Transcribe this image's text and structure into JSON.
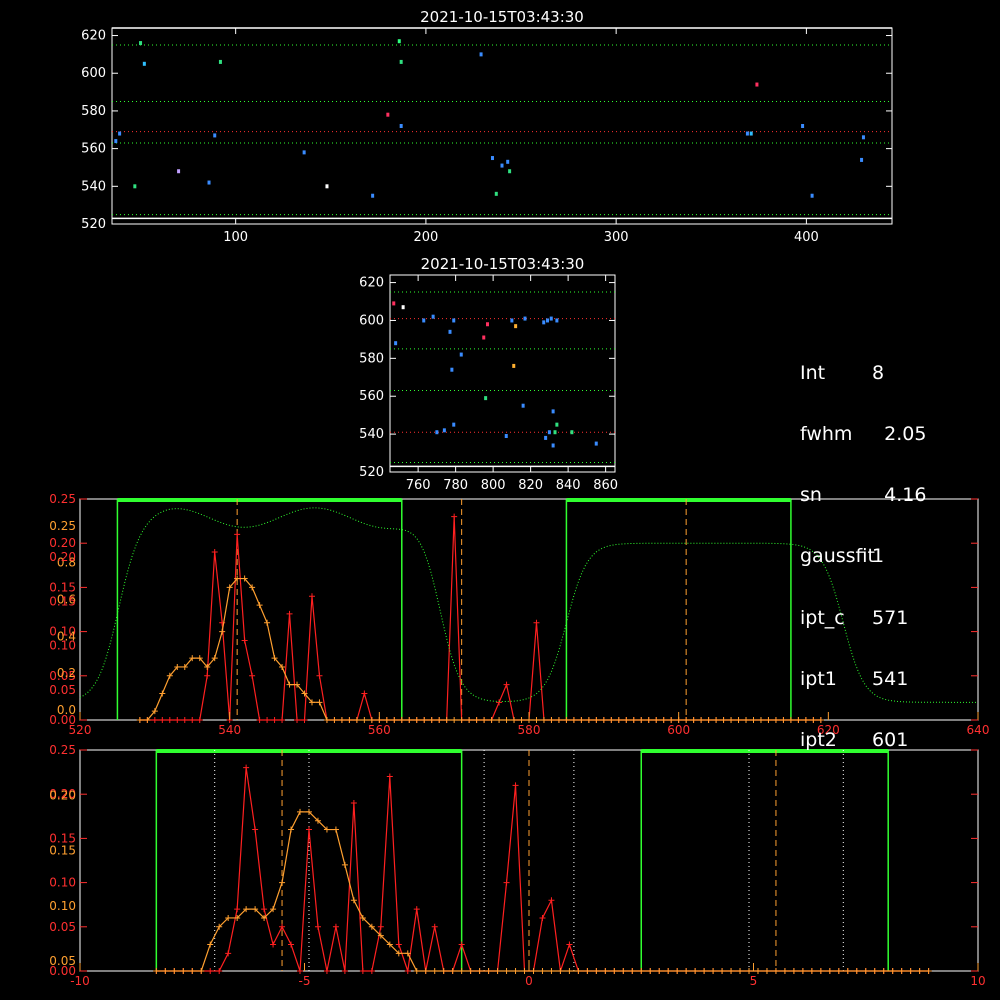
{
  "chart_data": [
    {
      "id": "top-image",
      "type": "scatter",
      "title": "2021-10-15T03:43:30",
      "xlim": [
        35,
        445
      ],
      "ylim": [
        520,
        624
      ],
      "xticks": [
        100,
        200,
        300,
        400
      ],
      "yticks": [
        520,
        540,
        560,
        580,
        600,
        620
      ],
      "hlines": [
        {
          "y": 569,
          "color": "#ff3030"
        },
        {
          "y": 585,
          "color": "#30ff30"
        },
        {
          "y": 563,
          "color": "#30ff30"
        },
        {
          "y": 615,
          "color": "#30ff30"
        },
        {
          "y": 525,
          "color": "#30ff30"
        },
        {
          "y": 624,
          "color": "#ffffff"
        },
        {
          "y": 523,
          "color": "#ffffff"
        }
      ],
      "points": [
        {
          "x": 37,
          "y": 564,
          "c": "#3a8cff"
        },
        {
          "x": 39,
          "y": 568,
          "c": "#3a8cff"
        },
        {
          "x": 47,
          "y": 540,
          "c": "#30e080"
        },
        {
          "x": 50,
          "y": 616,
          "c": "#30e080"
        },
        {
          "x": 52,
          "y": 605,
          "c": "#30c0ff"
        },
        {
          "x": 70,
          "y": 548,
          "c": "#c0a0ff"
        },
        {
          "x": 86,
          "y": 542,
          "c": "#3a8cff"
        },
        {
          "x": 89,
          "y": 567,
          "c": "#3a8cff"
        },
        {
          "x": 92,
          "y": 606,
          "c": "#30e080"
        },
        {
          "x": 136,
          "y": 558,
          "c": "#3a8cff"
        },
        {
          "x": 148,
          "y": 540,
          "c": "#ffffff"
        },
        {
          "x": 172,
          "y": 535,
          "c": "#3a8cff"
        },
        {
          "x": 180,
          "y": 578,
          "c": "#ff3060"
        },
        {
          "x": 186,
          "y": 617,
          "c": "#30ff80"
        },
        {
          "x": 187,
          "y": 606,
          "c": "#30e080"
        },
        {
          "x": 187,
          "y": 572,
          "c": "#3a8cff"
        },
        {
          "x": 229,
          "y": 610,
          "c": "#3a8cff"
        },
        {
          "x": 235,
          "y": 555,
          "c": "#3a8cff"
        },
        {
          "x": 237,
          "y": 536,
          "c": "#30e080"
        },
        {
          "x": 240,
          "y": 551,
          "c": "#3a8cff"
        },
        {
          "x": 243,
          "y": 553,
          "c": "#3a8cff"
        },
        {
          "x": 244,
          "y": 548,
          "c": "#30e080"
        },
        {
          "x": 369,
          "y": 568,
          "c": "#3a8cff"
        },
        {
          "x": 371,
          "y": 568,
          "c": "#30c0ff"
        },
        {
          "x": 374,
          "y": 594,
          "c": "#ff3060"
        },
        {
          "x": 398,
          "y": 572,
          "c": "#3a8cff"
        },
        {
          "x": 403,
          "y": 535,
          "c": "#3a8cff"
        },
        {
          "x": 429,
          "y": 554,
          "c": "#3a8cff"
        },
        {
          "x": 430,
          "y": 566,
          "c": "#3a8cff"
        }
      ]
    },
    {
      "id": "mid-image",
      "type": "scatter",
      "title": "2021-10-15T03:43:30",
      "xlim": [
        745,
        865
      ],
      "ylim": [
        520,
        624
      ],
      "xticks": [
        760,
        780,
        800,
        820,
        840,
        860
      ],
      "yticks": [
        520,
        540,
        560,
        580,
        600,
        620
      ],
      "hlines": [
        {
          "y": 601,
          "color": "#ff3030"
        },
        {
          "y": 541,
          "color": "#ff3030"
        },
        {
          "y": 615,
          "color": "#30ff30"
        },
        {
          "y": 585,
          "color": "#30ff30"
        },
        {
          "y": 563,
          "color": "#30ff30"
        },
        {
          "y": 525,
          "color": "#30ff30"
        },
        {
          "y": 523,
          "color": "#ffffff"
        }
      ],
      "points": [
        {
          "x": 747,
          "y": 609,
          "c": "#ff3060"
        },
        {
          "x": 748,
          "y": 588,
          "c": "#3a8cff"
        },
        {
          "x": 752,
          "y": 607,
          "c": "#ffffff"
        },
        {
          "x": 763,
          "y": 600,
          "c": "#3a8cff"
        },
        {
          "x": 768,
          "y": 602,
          "c": "#3a8cff"
        },
        {
          "x": 770,
          "y": 541,
          "c": "#3a8cff"
        },
        {
          "x": 774,
          "y": 542,
          "c": "#3a8cff"
        },
        {
          "x": 777,
          "y": 594,
          "c": "#3a8cff"
        },
        {
          "x": 778,
          "y": 574,
          "c": "#3a8cff"
        },
        {
          "x": 779,
          "y": 600,
          "c": "#3a8cff"
        },
        {
          "x": 779,
          "y": 545,
          "c": "#3a8cff"
        },
        {
          "x": 783,
          "y": 582,
          "c": "#3a8cff"
        },
        {
          "x": 795,
          "y": 591,
          "c": "#ff3060"
        },
        {
          "x": 796,
          "y": 559,
          "c": "#30e080"
        },
        {
          "x": 797,
          "y": 598,
          "c": "#ff3060"
        },
        {
          "x": 807,
          "y": 539,
          "c": "#3a8cff"
        },
        {
          "x": 810,
          "y": 600,
          "c": "#3a8cff"
        },
        {
          "x": 811,
          "y": 576,
          "c": "#ffb030"
        },
        {
          "x": 812,
          "y": 597,
          "c": "#ffb030"
        },
        {
          "x": 816,
          "y": 555,
          "c": "#3a8cff"
        },
        {
          "x": 817,
          "y": 601,
          "c": "#3a8cff"
        },
        {
          "x": 827,
          "y": 599,
          "c": "#3a8cff"
        },
        {
          "x": 828,
          "y": 538,
          "c": "#3a8cff"
        },
        {
          "x": 829,
          "y": 600,
          "c": "#3a8cff"
        },
        {
          "x": 830,
          "y": 541,
          "c": "#3a8cff"
        },
        {
          "x": 831,
          "y": 601,
          "c": "#3a8cff"
        },
        {
          "x": 832,
          "y": 552,
          "c": "#3a8cff"
        },
        {
          "x": 832,
          "y": 534,
          "c": "#3a8cff"
        },
        {
          "x": 833,
          "y": 541,
          "c": "#30e080"
        },
        {
          "x": 834,
          "y": 600,
          "c": "#3a8cff"
        },
        {
          "x": 834,
          "y": 545,
          "c": "#30e080"
        },
        {
          "x": 842,
          "y": 541,
          "c": "#30e080"
        },
        {
          "x": 855,
          "y": 535,
          "c": "#3a8cff"
        }
      ]
    },
    {
      "id": "profile-pixel",
      "type": "line",
      "xlim": [
        520,
        640
      ],
      "xticks": [
        520,
        540,
        560,
        580,
        600,
        620,
        640
      ],
      "yleft_ticks": [
        "0.00",
        "0.05",
        "0.10",
        "0.15",
        "0.20",
        "0.25"
      ],
      "yleft2_ticks": [
        "0.0",
        "0.2",
        "0.4",
        "0.6",
        "0.8",
        "0.25"
      ],
      "yleft3_ticks": [
        "0.05",
        "0.10",
        "0.15",
        "0.20"
      ],
      "ylim": [
        0,
        0.25
      ],
      "windows": [
        [
          525,
          563
        ],
        [
          585,
          615
        ]
      ],
      "vlines_dashed": [
        541,
        571,
        601
      ],
      "x": [
        528,
        529,
        530,
        531,
        532,
        533,
        534,
        535,
        536,
        537,
        538,
        539,
        540,
        541,
        542,
        543,
        544,
        545,
        546,
        547,
        548,
        549,
        550,
        551,
        552,
        553,
        554,
        555,
        556,
        557,
        558,
        559,
        560,
        561,
        562,
        563,
        564,
        565,
        566,
        567,
        568,
        569,
        570,
        571,
        572,
        573,
        574,
        575,
        576,
        577,
        578,
        579,
        580,
        581,
        582,
        583,
        584,
        585,
        586,
        587,
        588,
        589,
        590,
        591,
        592,
        593,
        594,
        595,
        596,
        597,
        598,
        599,
        600,
        601,
        602,
        603,
        604,
        605,
        606,
        607,
        608,
        609,
        610,
        611,
        612,
        613,
        614,
        615,
        616,
        617,
        618,
        619
      ],
      "series": [
        {
          "color": "#ff2020",
          "values": [
            0.0,
            0.0,
            0.0,
            0.0,
            0.0,
            0.0,
            0.0,
            0.0,
            0.0,
            0.05,
            0.19,
            0.11,
            0.0,
            0.21,
            0.09,
            0.05,
            0.0,
            0.0,
            0.0,
            0.0,
            0.12,
            0.0,
            0.0,
            0.14,
            0.05,
            0.0,
            0.0,
            0.0,
            0.0,
            0.0,
            0.03,
            0.0,
            0.0,
            0.0,
            0.0,
            0.0,
            0.0,
            0.0,
            0.0,
            0.0,
            0.0,
            0.0,
            0.23,
            0.0,
            0.0,
            0.0,
            0.0,
            0.0,
            0.02,
            0.04,
            0.0,
            0.0,
            0.0,
            0.11,
            0.0,
            0.0,
            0.0,
            0.0,
            0.0,
            0.0,
            0.0,
            0.0,
            0.0,
            0.0,
            0.0,
            0.0,
            0.0,
            0.0,
            0.0,
            0.0,
            0.0,
            0.0,
            0.0,
            0.0,
            0.0,
            0.0,
            0.0,
            0.0,
            0.0,
            0.0,
            0.0,
            0.0,
            0.0,
            0.0,
            0.0,
            0.0,
            0.0,
            0.0,
            0.0,
            0.0,
            0.0,
            0.0
          ]
        },
        {
          "color": "#ffa030",
          "values": [
            0.0,
            0.0,
            0.01,
            0.03,
            0.05,
            0.06,
            0.06,
            0.07,
            0.07,
            0.06,
            0.07,
            0.1,
            0.15,
            0.16,
            0.16,
            0.15,
            0.13,
            0.11,
            0.07,
            0.06,
            0.04,
            0.04,
            0.03,
            0.02,
            0.02,
            0.0,
            0.0,
            0.0,
            0.0,
            0.0,
            0.0,
            0.0,
            0.0,
            0.0,
            0.0,
            0.0,
            0.0,
            0.0,
            0.0,
            0.0,
            0.0,
            0.0,
            0.0,
            0.0,
            0.0,
            0.0,
            0.0,
            0.0,
            0.0,
            0.0,
            0.0,
            0.0,
            0.0,
            0.0,
            0.0,
            0.0,
            0.0,
            0.0,
            0.0,
            0.0,
            0.0,
            0.0,
            0.0,
            0.0,
            0.0,
            0.0,
            0.0,
            0.0,
            0.0,
            0.0,
            0.0,
            0.0,
            0.0,
            0.0,
            0.0,
            0.0,
            0.0,
            0.0,
            0.0,
            0.0,
            0.0,
            0.0,
            0.0,
            0.0,
            0.0,
            0.0,
            0.0,
            0.0,
            0.0,
            0.0,
            0.0,
            0.0
          ]
        }
      ]
    },
    {
      "id": "profile-offset",
      "type": "line",
      "xlim": [
        -10,
        10
      ],
      "xticks": [
        -10,
        -5,
        0,
        5,
        10
      ],
      "yleft_ticks": [
        "0.00",
        "0.05",
        "0.10",
        "0.15",
        "0.20",
        "0.25"
      ],
      "yleft2_ticks": [
        "0.05",
        "0.10",
        "0.15",
        "0.20"
      ],
      "ylim": [
        0,
        0.25
      ],
      "windows": [
        [
          -8.3,
          -1.5
        ],
        [
          2.5,
          8.0
        ]
      ],
      "vlines_dashed": [
        -5.5,
        0,
        5.5
      ],
      "vlines_dotted": [
        -7,
        -4.9,
        -1,
        1,
        4.9,
        7
      ],
      "x": [
        -8.3,
        -8.1,
        -7.9,
        -7.7,
        -7.5,
        -7.3,
        -7.1,
        -6.9,
        -6.7,
        -6.5,
        -6.3,
        -6.1,
        -5.9,
        -5.7,
        -5.5,
        -5.3,
        -5.1,
        -4.9,
        -4.7,
        -4.5,
        -4.3,
        -4.1,
        -3.9,
        -3.7,
        -3.5,
        -3.3,
        -3.1,
        -2.9,
        -2.7,
        -2.5,
        -2.3,
        -2.1,
        -1.9,
        -1.7,
        -1.5,
        -1.3,
        -1.1,
        -0.9,
        -0.7,
        -0.5,
        -0.3,
        -0.1,
        0.1,
        0.3,
        0.5,
        0.7,
        0.9,
        1.1,
        1.3,
        1.5,
        1.7,
        1.9,
        2.1,
        2.3,
        2.5,
        2.7,
        2.9,
        3.1,
        3.3,
        3.5,
        3.7,
        3.9,
        4.1,
        4.3,
        4.5,
        4.7,
        4.9,
        5.1,
        5.3,
        5.5,
        5.7,
        5.9,
        6.1,
        6.3,
        6.5,
        6.7,
        6.9,
        7.1,
        7.3,
        7.5,
        7.7,
        7.9,
        8.1,
        8.3,
        8.5,
        8.7,
        8.9
      ],
      "series": [
        {
          "color": "#ff2020",
          "values": [
            0.0,
            0.0,
            0.0,
            0.0,
            0.0,
            0.0,
            0.0,
            0.0,
            0.02,
            0.07,
            0.23,
            0.16,
            0.07,
            0.03,
            0.05,
            0.03,
            0.0,
            0.16,
            0.05,
            0.0,
            0.05,
            0.0,
            0.19,
            0.0,
            0.0,
            0.05,
            0.22,
            0.03,
            0.0,
            0.07,
            0.0,
            0.05,
            0.0,
            0.0,
            0.03,
            0.0,
            0.0,
            0.0,
            0.0,
            0.1,
            0.21,
            0.0,
            0.0,
            0.06,
            0.08,
            0.0,
            0.03,
            0.0,
            0.0,
            0.0,
            0.0,
            0.0,
            0.0,
            0.0,
            0.0,
            0.0,
            0.0,
            0.0,
            0.0,
            0.0,
            0.0,
            0.0,
            0.0,
            0.0,
            0.0,
            0.0,
            0.0,
            0.0,
            0.0,
            0.0,
            0.0,
            0.0,
            0.0,
            0.0,
            0.0,
            0.0,
            0.0,
            0.0,
            0.0,
            0.0,
            0.0,
            0.0,
            0.0,
            0.0,
            0.0,
            0.0,
            0.0
          ]
        },
        {
          "color": "#ffa030",
          "values": [
            0.0,
            0.0,
            0.0,
            0.0,
            0.0,
            0.0,
            0.03,
            0.05,
            0.06,
            0.06,
            0.07,
            0.07,
            0.06,
            0.07,
            0.1,
            0.16,
            0.18,
            0.18,
            0.17,
            0.16,
            0.16,
            0.12,
            0.08,
            0.06,
            0.05,
            0.04,
            0.03,
            0.02,
            0.02,
            0.0,
            0.0,
            0.0,
            0.0,
            0.0,
            0.0,
            0.0,
            0.0,
            0.0,
            0.0,
            0.0,
            0.0,
            0.0,
            0.0,
            0.0,
            0.0,
            0.0,
            0.0,
            0.0,
            0.0,
            0.0,
            0.0,
            0.0,
            0.0,
            0.0,
            0.0,
            0.0,
            0.0,
            0.0,
            0.0,
            0.0,
            0.0,
            0.0,
            0.0,
            0.0,
            0.0,
            0.0,
            0.0,
            0.0,
            0.0,
            0.0,
            0.0,
            0.0,
            0.0,
            0.0,
            0.0,
            0.0,
            0.0,
            0.0,
            0.0,
            0.0,
            0.0,
            0.0,
            0.0,
            0.0,
            0.0,
            0.0,
            0.0
          ]
        }
      ]
    }
  ],
  "info_panel": {
    "rows": [
      {
        "key": "Int",
        "value": "8"
      },
      {
        "key": "fwhm",
        "value": "2.05"
      },
      {
        "key": "sn",
        "value": "4.16"
      },
      {
        "key": "gaussfit",
        "value": "1"
      },
      {
        "key": "ipt_c",
        "value": "571"
      },
      {
        "key": "ipt1",
        "value": "541"
      },
      {
        "key": "ipt2",
        "value": "601"
      }
    ]
  }
}
